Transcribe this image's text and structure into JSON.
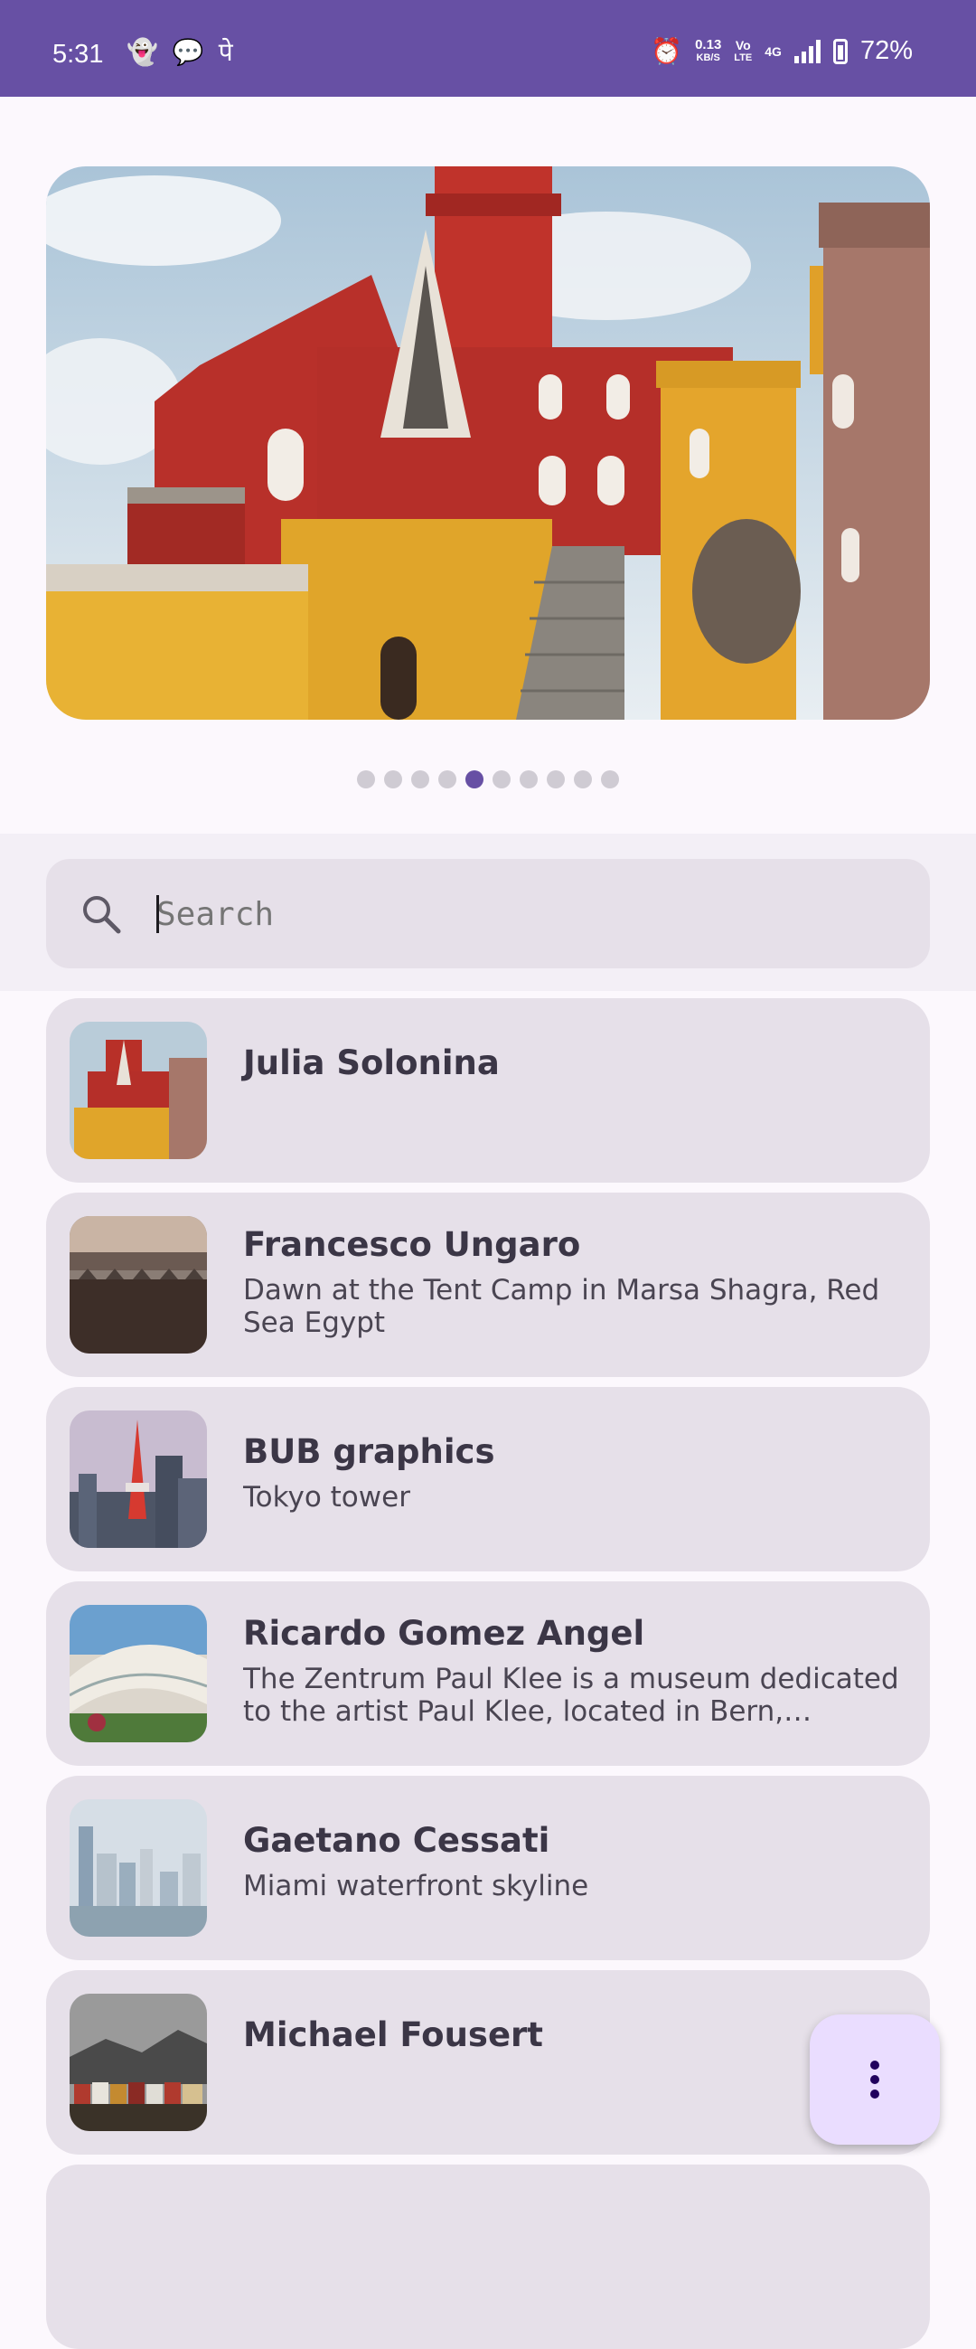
{
  "status_bar": {
    "time": "5:31",
    "speed_value": "0.13",
    "speed_unit": "KB/S",
    "volte_top": "Vo",
    "volte_bottom": "LTE",
    "network": "4G",
    "battery_percent": "72%"
  },
  "carousel": {
    "page_count": 10,
    "active_index": 4
  },
  "search": {
    "placeholder": "Search"
  },
  "items": [
    {
      "author": "Julia Solonina",
      "description": ""
    },
    {
      "author": "Francesco Ungaro",
      "description": "Dawn at the Tent Camp in Marsa Shagra, Red Sea Egypt"
    },
    {
      "author": "BUB graphics",
      "description": "Tokyo tower"
    },
    {
      "author": "Ricardo Gomez Angel",
      "description": "The Zentrum Paul Klee is a museum dedicated to the artist Paul Klee, located in Bern, Switzerlan…"
    },
    {
      "author": "Gaetano Cessati",
      "description": "Miami waterfront skyline"
    },
    {
      "author": "Michael Fousert",
      "description": ""
    }
  ],
  "colors": {
    "primary": "#6750a4",
    "card": "#e6e0e9",
    "fab": "#eaddff"
  },
  "icons": {
    "search": "search-icon",
    "fab": "more-vert-icon"
  }
}
